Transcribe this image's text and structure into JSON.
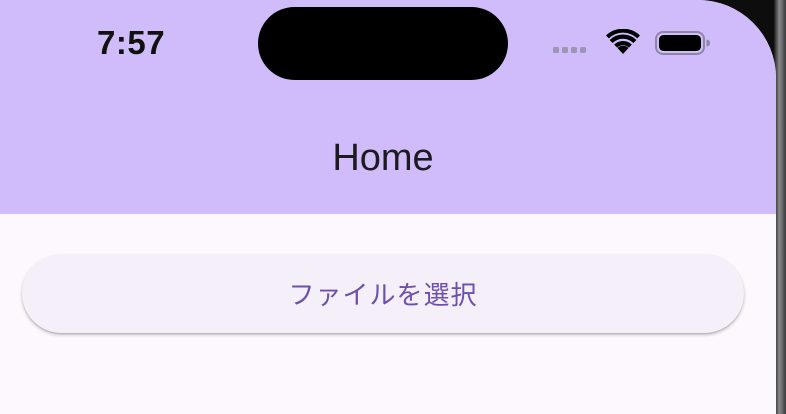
{
  "status_bar": {
    "time": "7:57",
    "icons": [
      "signal-dots-icon",
      "wifi-icon",
      "battery-icon"
    ]
  },
  "app_bar": {
    "title": "Home",
    "background": "#d1bcfb"
  },
  "main": {
    "select_file_button": {
      "label": "ファイルを選択",
      "text_color": "#6c4fae"
    }
  }
}
